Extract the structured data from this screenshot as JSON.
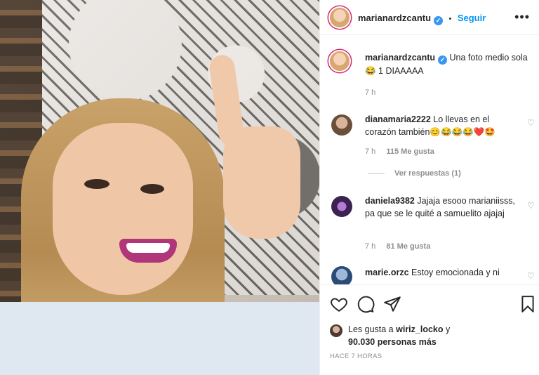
{
  "post": {
    "author": "marianardzcantu",
    "follow_label": "Seguir",
    "separator": "•",
    "more_label": "•••"
  },
  "caption": {
    "username": "marianardzcantu",
    "text": "Una foto medio sola 😂 1 DIAAAAA",
    "time": "7 h"
  },
  "comments": [
    {
      "username": "dianamaria2222",
      "text": "Lo llevas en el corazón también😊😂😂😂❤️🤩",
      "time": "7 h",
      "likes": "115 Me gusta",
      "replies": "Ver respuestas (1)"
    },
    {
      "username": "daniela9382",
      "text": "Jajaja esooo marianiisss, pa que se le quité a samuelito ajajaj",
      "time": "7 h",
      "likes": "81 Me gusta"
    },
    {
      "username": "marie.orzc",
      "text": "Estoy emocionada y ni"
    }
  ],
  "likes": {
    "prefix": "Les gusta a",
    "user": "wiriz_locko",
    "suffix": "y",
    "count": "90.030 personas más"
  },
  "posted": "HACE 7 HORAS",
  "colors": {
    "accent": "#0095f6",
    "muted": "#8e8e8e",
    "text": "#262626"
  },
  "icons": [
    "heart-icon",
    "comment-icon",
    "share-icon",
    "bookmark-icon",
    "verified-icon",
    "more-icon"
  ]
}
